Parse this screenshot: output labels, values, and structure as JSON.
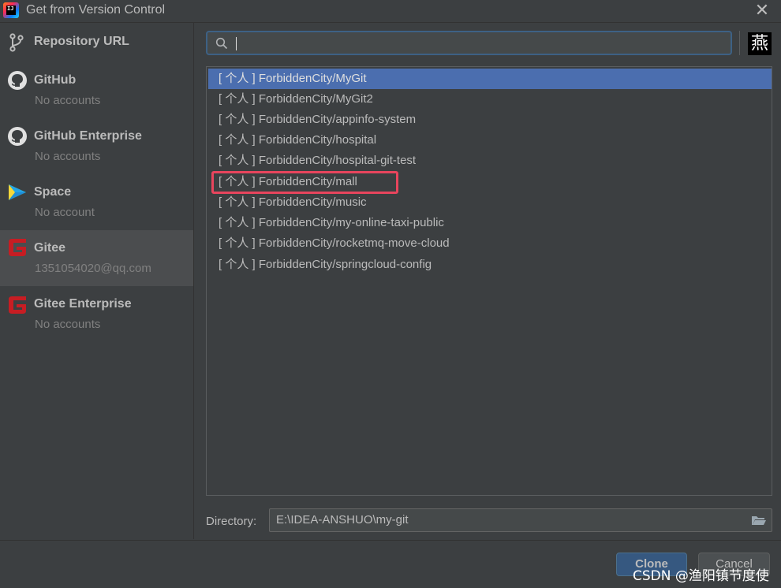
{
  "window": {
    "title": "Get from Version Control",
    "app_icon_text": "IJ"
  },
  "sidebar": {
    "items": [
      {
        "title": "Repository URL",
        "subtitle": ""
      },
      {
        "title": "GitHub",
        "subtitle": "No accounts"
      },
      {
        "title": "GitHub Enterprise",
        "subtitle": "No accounts"
      },
      {
        "title": "Space",
        "subtitle": "No account"
      },
      {
        "title": "Gitee",
        "subtitle": "1351054020@qq.com"
      },
      {
        "title": "Gitee Enterprise",
        "subtitle": "No accounts"
      }
    ],
    "selected_index": 4
  },
  "search": {
    "value": "",
    "avatar_char": "燕"
  },
  "repositories": {
    "items": [
      "[ 个人 ] ForbiddenCity/MyGit",
      "[ 个人 ] ForbiddenCity/MyGit2",
      "[ 个人 ] ForbiddenCity/appinfo-system",
      "[ 个人 ] ForbiddenCity/hospital",
      "[ 个人 ] ForbiddenCity/hospital-git-test",
      "[ 个人 ] ForbiddenCity/mall",
      "[ 个人 ] ForbiddenCity/music",
      "[ 个人 ] ForbiddenCity/my-online-taxi-public",
      "[ 个人 ] ForbiddenCity/rocketmq-move-cloud",
      "[ 个人 ] ForbiddenCity/springcloud-config"
    ],
    "selected_index": 0,
    "highlighted_index": 5
  },
  "directory": {
    "label": "Directory:",
    "value": "E:\\IDEA-ANSHUO\\my-git"
  },
  "buttons": {
    "clone": "Clone",
    "cancel": "Cancel"
  },
  "watermark": "CSDN @渔阳镇节度使",
  "colors": {
    "background": "#3c3f41",
    "selection": "#4b6eaf",
    "highlight_border": "#e8455d",
    "gitee_red": "#c71d23",
    "primary_button": "#365880"
  }
}
